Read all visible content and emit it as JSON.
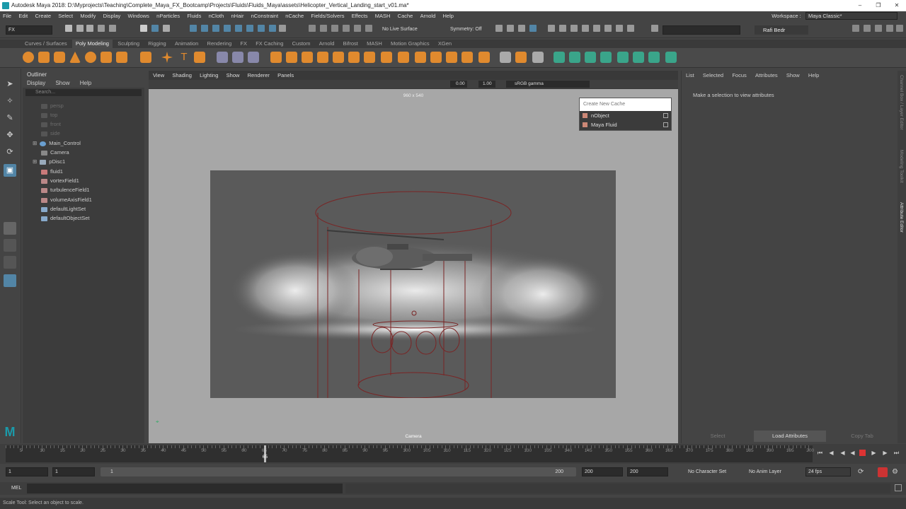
{
  "window": {
    "title": "Autodesk Maya 2018: D:\\Myprojects\\Teaching\\Complete_Maya_FX_Bootcamp\\Projects\\Fluids\\Fluids_Maya\\assets\\Helicopter_Vertical_Landing_start_v01.ma*"
  },
  "menubar": {
    "items": [
      "File",
      "Edit",
      "Create",
      "Select",
      "Modify",
      "Display",
      "Windows",
      "nParticles",
      "Fluids",
      "nCloth",
      "nHair",
      "nConstraint",
      "nCache",
      "Fields/Solvers",
      "Effects",
      "MASH",
      "Cache",
      "Arnold",
      "Help"
    ],
    "workspace_label": "Workspace :",
    "workspace_value": "Maya Classic*"
  },
  "statusline": {
    "menuset": "FX",
    "live_surface": "No Live Surface",
    "symmetry": "Symmetry: Off",
    "user": "Rafi Bedr"
  },
  "shelf": {
    "tabs": [
      "Curves / Surfaces",
      "Poly Modeling",
      "Sculpting",
      "Rigging",
      "Animation",
      "Rendering",
      "FX",
      "FX Caching",
      "Custom",
      "Arnold",
      "Bifrost",
      "MASH",
      "Motion Graphics",
      "XGen"
    ],
    "active_tab": "Poly Modeling"
  },
  "outliner": {
    "title": "Outliner",
    "menus": [
      "Display",
      "Show",
      "Help"
    ],
    "search_placeholder": "Search...",
    "items": [
      {
        "label": "persp",
        "dim": true,
        "icon": "camera-icon"
      },
      {
        "label": "top",
        "dim": true,
        "icon": "camera-icon"
      },
      {
        "label": "front",
        "dim": true,
        "icon": "camera-icon"
      },
      {
        "label": "side",
        "dim": true,
        "icon": "camera-icon"
      },
      {
        "label": "Main_Control",
        "dim": false,
        "icon": "curve-icon",
        "expandable": true
      },
      {
        "label": "Camera",
        "dim": false,
        "icon": "camera-icon"
      },
      {
        "label": "pDisc1",
        "dim": false,
        "icon": "mesh-icon",
        "expandable": true
      },
      {
        "label": "fluid1",
        "dim": false,
        "icon": "fluid-icon"
      },
      {
        "label": "vortexField1",
        "dim": false,
        "icon": "field-icon"
      },
      {
        "label": "turbulenceField1",
        "dim": false,
        "icon": "field-icon"
      },
      {
        "label": "volumeAxisField1",
        "dim": false,
        "icon": "field-icon"
      },
      {
        "label": "defaultLightSet",
        "dim": false,
        "icon": "set-icon"
      },
      {
        "label": "defaultObjectSet",
        "dim": false,
        "icon": "set-icon"
      }
    ]
  },
  "viewport": {
    "menus": [
      "View",
      "Shading",
      "Lighting",
      "Show",
      "Renderer",
      "Panels"
    ],
    "exposure": "0.00",
    "gamma": "1.00",
    "color_space": "sRGB gamma",
    "resolution": "960 x 540",
    "camera_label": "Camera"
  },
  "cache_panel": {
    "title": "Create New Cache",
    "items": [
      "nObject",
      "Maya Fluid"
    ]
  },
  "attribute_editor": {
    "menus": [
      "List",
      "Selected",
      "Focus",
      "Attributes",
      "Show",
      "Help"
    ],
    "message": "Make a selection to view attributes",
    "buttons": [
      "Select",
      "Load Attributes",
      "Copy Tab"
    ]
  },
  "side_tabs": [
    "Channel Box / Layer Editor",
    "Modeling Toolkit",
    "Attribute Editor"
  ],
  "timeline": {
    "labels": [
      "5",
      "10",
      "15",
      "20",
      "25",
      "30",
      "35",
      "40",
      "45",
      "50",
      "55",
      "60",
      "65",
      "70",
      "75",
      "80",
      "85",
      "90",
      "95",
      "100",
      "105",
      "110",
      "115",
      "120",
      "125",
      "130",
      "135",
      "140",
      "145",
      "150",
      "155",
      "160",
      "165",
      "170",
      "175",
      "180",
      "185",
      "190",
      "195",
      "200"
    ],
    "current_frame": "65"
  },
  "range": {
    "start": "1",
    "anim_start": "1",
    "slider_start": "1",
    "slider_end": "200",
    "anim_end": "200",
    "end": "200",
    "character_set": "No Character Set",
    "anim_layer": "No Anim Layer",
    "fps": "24 fps"
  },
  "command_line": {
    "language": "MEL"
  },
  "help_line": {
    "text": "Scale Tool: Select an object to scale."
  },
  "colors": {
    "accent": "#5285a6",
    "viewport_bg": "#a7a7a7",
    "fluid_container": "#8a2a2a"
  }
}
